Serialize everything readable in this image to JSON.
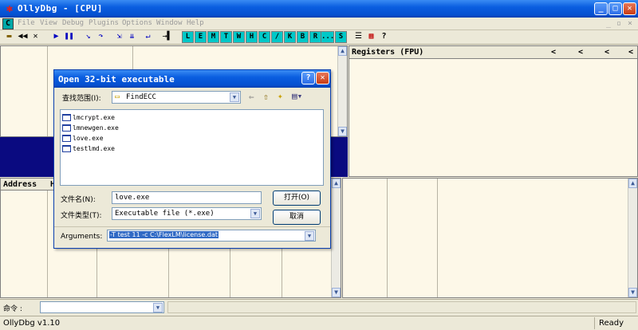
{
  "window": {
    "title": "OllyDbg - [CPU]"
  },
  "menu": [
    "File",
    "View",
    "Debug",
    "Plugins",
    "Options",
    "Window",
    "Help"
  ],
  "toolbar": {
    "letters": [
      "L",
      "E",
      "M",
      "T",
      "W",
      "H",
      "C",
      "/",
      "K",
      "B",
      "R",
      "...",
      "S"
    ]
  },
  "registers": {
    "title": "Registers (FPU)",
    "nav": [
      "<",
      "<",
      "<",
      "<"
    ]
  },
  "dump": {
    "col_address": "Address",
    "col_hex": "H"
  },
  "dialog": {
    "title": "Open 32-bit executable",
    "lookin_label": "查找范围(I):",
    "lookin_value": "FindECC",
    "files": [
      "lmcrypt.exe",
      "lmnewgen.exe",
      "love.exe",
      "testlmd.exe"
    ],
    "filename_label": "文件名(N):",
    "filename_value": "love.exe",
    "filetype_label": "文件类型(T):",
    "filetype_value": "Executable file (*.exe)",
    "open_button": "打开(O)",
    "cancel_button": "取消",
    "arguments_label": "Arguments:",
    "arguments_value": "-T test 11 -c C:\\FlexLM\\license.dat"
  },
  "command": {
    "label": "命令 :"
  },
  "status": {
    "left": "OllyDbg v1.10",
    "right": "Ready"
  }
}
